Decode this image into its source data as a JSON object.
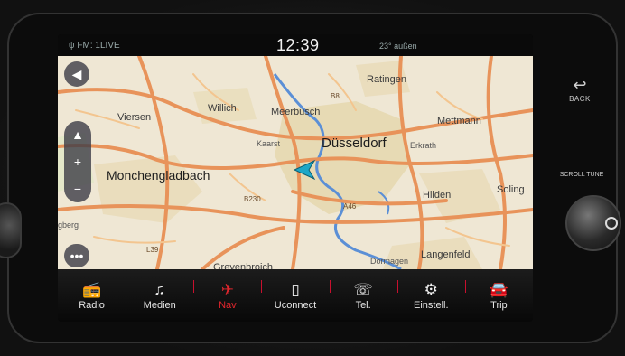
{
  "status": {
    "radio_label": "FM: 1LIVE",
    "antenna_icon": "antenna-icon",
    "time": "12:39",
    "temperature": "23° außen"
  },
  "map": {
    "labels": {
      "ratingen": "Ratingen",
      "viersen": "Viersen",
      "willich": "Willich",
      "meerbusch": "Meerbusch",
      "mettmann": "Mettmann",
      "kaarst": "Kaarst",
      "duesseldorf": "Düsseldorf",
      "erkrath": "Erkrath",
      "moenchengladbach": "Monchengladbach",
      "hilden": "Hilden",
      "solingen": "Soling",
      "berg": "gberg",
      "dormagen": "Dormagen",
      "langenfeld": "Langenfeld",
      "grevenbroich": "Grevenbroich",
      "road_b230": "B230",
      "road_l39": "L39",
      "road_b8": "B8",
      "road_a46": "A46"
    },
    "controls": {
      "back_icon": "back-arrow-icon",
      "zoom_in_icon": "zoom-in-icon",
      "zoom_out_icon": "zoom-out-icon",
      "more_icon": "more-icon"
    },
    "position_icon": "vehicle-position-icon"
  },
  "menu": {
    "items": [
      {
        "label": "Radio",
        "icon": "radio-icon"
      },
      {
        "label": "Medien",
        "icon": "media-icon"
      },
      {
        "label": "Nav",
        "icon": "nav-icon"
      },
      {
        "label": "Uconnect",
        "icon": "uconnect-icon"
      },
      {
        "label": "Tel.",
        "icon": "phone-icon"
      },
      {
        "label": "Einstell.",
        "icon": "settings-icon"
      },
      {
        "label": "Trip",
        "icon": "trip-icon"
      }
    ]
  },
  "hardware": {
    "back_label": "BACK",
    "scroll_label": "SCROLL TUNE"
  },
  "colors": {
    "accent": "#e1262d",
    "map_bg": "#efe7d4",
    "road": "#e8935a",
    "water": "#5b8fd6"
  }
}
